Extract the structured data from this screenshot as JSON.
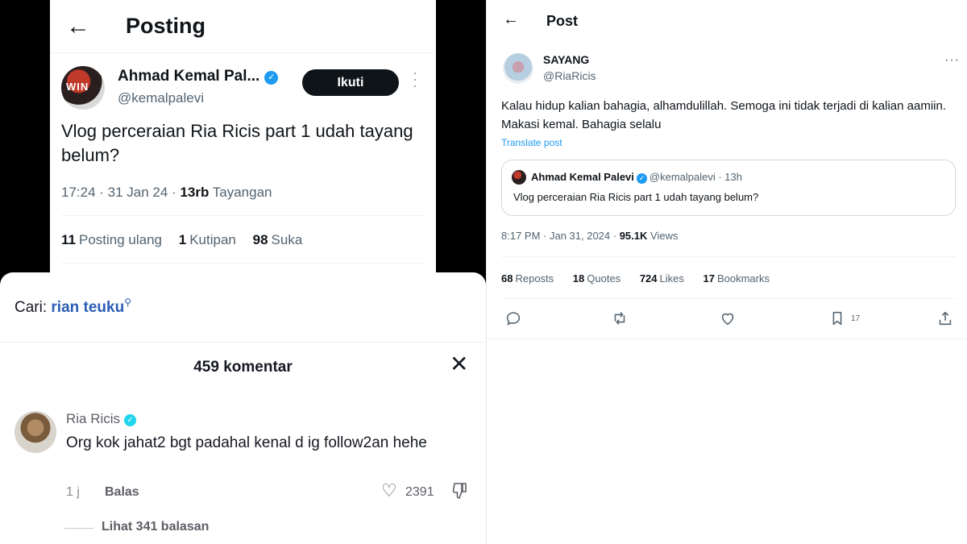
{
  "left_post": {
    "header_title": "Posting",
    "back_icon": "arrow-left-icon",
    "author_name": "Ahmad Kemal Pal...",
    "author_handle": "@kemalpalevi",
    "avatar_text": "WIN",
    "follow_label": "Ikuti",
    "text": "Vlog perceraian Ria Ricis part 1 udah tayang belum?",
    "time": "17:24 · 31 Jan 24 · ",
    "views_count": "13rb",
    "views_label": " Tayangan",
    "reposts_count": "11",
    "reposts_label": "Posting ulang",
    "quotes_count": "1",
    "quotes_label": "Kutipan",
    "likes_count": "98",
    "likes_label": "Suka"
  },
  "comments_sheet": {
    "search_label": "Cari: ",
    "search_query": "rian teuku",
    "count_title": "459 komentar",
    "comment": {
      "author": "Ria Ricis",
      "text": "Org kok jahat2 bgt padahal kenal d ig follow2an hehe",
      "time": "1 j",
      "reply_label": "Balas",
      "likes": "2391",
      "view_replies": "Lihat 341 balasan"
    }
  },
  "right_post": {
    "header_title": "Post",
    "author_name": "SAYANG",
    "author_handle": "@RiaRicis",
    "text": "Kalau hidup kalian bahagia, alhamdulillah. Semoga ini tidak terjadi di kalian aamiin. Makasi kemal. Bahagia selalu",
    "translate_label": "Translate post",
    "quote": {
      "author_name": "Ahmad Kemal Palevi",
      "author_handle": "@kemalpalevi · 13h",
      "text": "Vlog perceraian Ria Ricis part 1 udah tayang belum?"
    },
    "time": "8:17 PM · Jan 31, 2024 · ",
    "views_count": "95.1K",
    "views_label": " Views",
    "reposts_count": "68",
    "reposts_label": "Reposts",
    "quotes_count": "18",
    "quotes_label": "Quotes",
    "likes_count": "724",
    "likes_label": "Likes",
    "bookmarks_count": "17",
    "bookmarks_label": "Bookmarks",
    "bookmark_action_count": "17"
  }
}
